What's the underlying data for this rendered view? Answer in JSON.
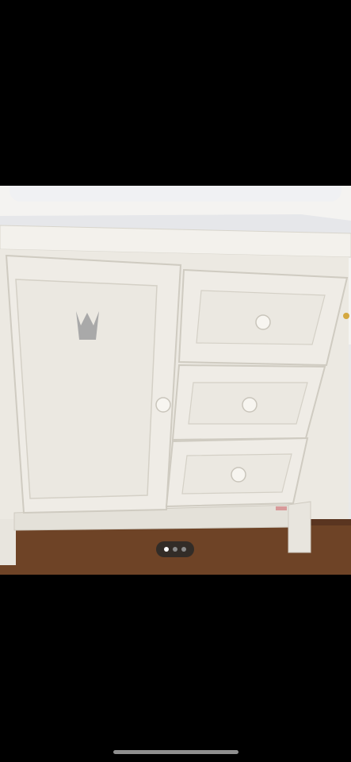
{
  "viewer": {
    "background_color": "#000000",
    "image_description_icon": "photo-of-white-cabinet"
  },
  "gallery": {
    "current_page": 1,
    "total_pages": 3,
    "dots": [
      {
        "active": true
      },
      {
        "active": false
      },
      {
        "active": false
      }
    ]
  },
  "colors": {
    "cabinet_white": "#ece9e2",
    "floor_wood": "#6b3f22",
    "crown_grey": "#a9a9a9"
  }
}
